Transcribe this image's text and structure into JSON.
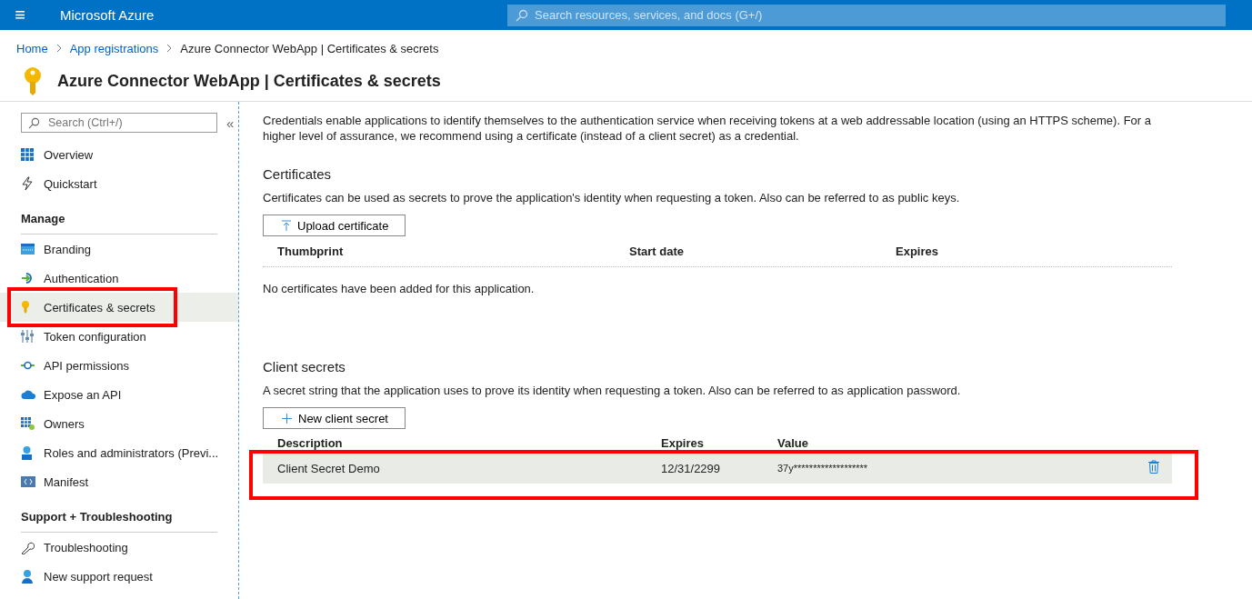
{
  "top_bar": {
    "menu": "≡",
    "brand": "Microsoft Azure",
    "search": {
      "placeholder": "Search resources, services, and docs (G+/)"
    }
  },
  "breadcrumb": [
    {
      "label": "Home",
      "link": true
    },
    {
      "label": "App registrations",
      "link": true
    },
    {
      "label": "Azure Connector WebApp | Certificates & secrets",
      "link": false
    }
  ],
  "page_title": "Azure Connector WebApp | Certificates & secrets",
  "sidebar": {
    "search": {
      "placeholder": "Search (Ctrl+/)"
    },
    "collapse": "«",
    "items": [
      {
        "kind": "item",
        "label": "Overview",
        "selected": false
      },
      {
        "kind": "item",
        "label": "Quickstart",
        "selected": false
      },
      {
        "kind": "heading",
        "label": "Manage"
      },
      {
        "kind": "item",
        "label": "Branding",
        "selected": false
      },
      {
        "kind": "item",
        "label": "Authentication",
        "selected": false
      },
      {
        "kind": "item",
        "label": "Certificates & secrets",
        "selected": true
      },
      {
        "kind": "item",
        "label": "Token configuration",
        "selected": false
      },
      {
        "kind": "item",
        "label": "API permissions",
        "selected": false
      },
      {
        "kind": "item",
        "label": "Expose an API",
        "selected": false
      },
      {
        "kind": "item",
        "label": "Owners",
        "selected": false
      },
      {
        "kind": "item",
        "label": "Roles and administrators (Previ...",
        "selected": false
      },
      {
        "kind": "item",
        "label": "Manifest",
        "selected": false
      },
      {
        "kind": "heading",
        "label": "Support + Troubleshooting"
      },
      {
        "kind": "item",
        "label": "Troubleshooting",
        "selected": false
      },
      {
        "kind": "item",
        "label": "New support request",
        "selected": false
      }
    ]
  },
  "intro": "Credentials enable applications to identify themselves to the authentication service when receiving tokens at a web addressable location (using an HTTPS scheme). For a higher level of assurance, we recommend using a certificate (instead of a client secret) as a credential.",
  "certificates": {
    "title": "Certificates",
    "description": "Certificates can be used as secrets to prove the application's identity when requesting a token. Also can be referred to as public keys.",
    "button": "Upload certificate",
    "columns": [
      "Thumbprint",
      "Start date",
      "Expires"
    ],
    "empty": "No certificates have been added for this application."
  },
  "client_secrets": {
    "title": "Client secrets",
    "description": "A secret string that the application uses to prove its identity when requesting a token. Also can be referred to as application password.",
    "button": "New client secret",
    "columns": [
      "Description",
      "Expires",
      "Value"
    ],
    "rows": [
      {
        "description": "Client Secret Demo",
        "expires": "12/31/2299",
        "value": "37y*******************",
        "selected": true
      }
    ]
  },
  "highlight_frames": {
    "sidebar_item": true,
    "secret_row": true
  }
}
